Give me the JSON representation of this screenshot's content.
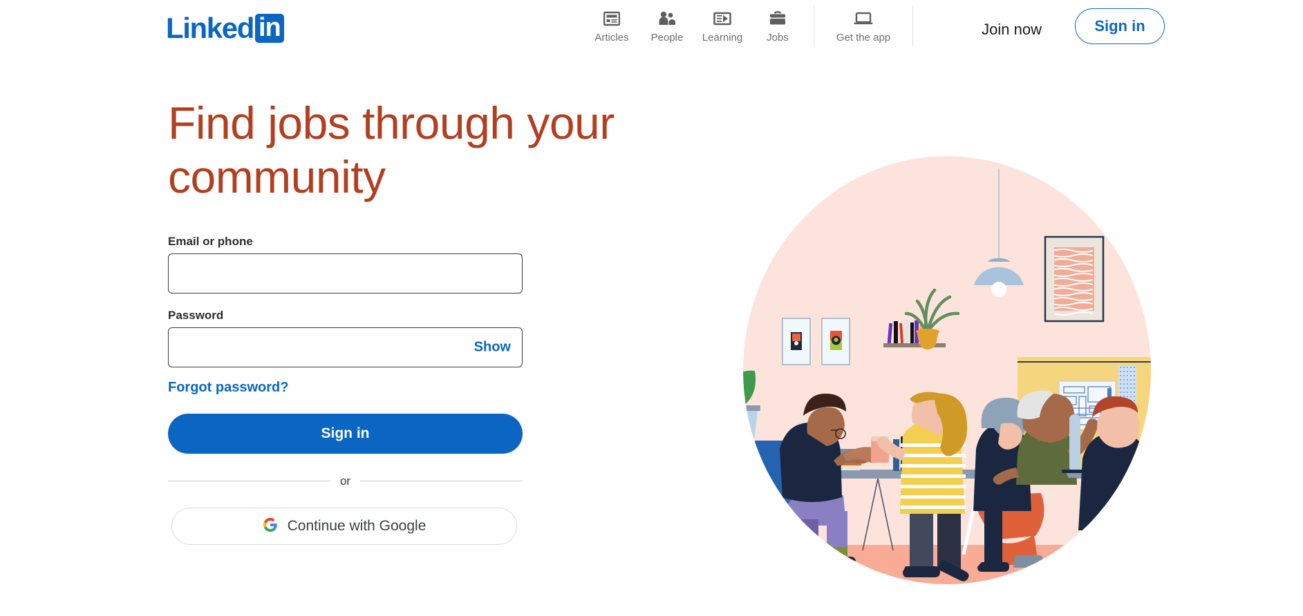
{
  "brand": {
    "logo_word": "Linked",
    "logo_in": "in",
    "accent_blue": "#0a66c2",
    "headline_color": "#b24020"
  },
  "header": {
    "nav": [
      {
        "label": "Articles",
        "icon": "articles-icon"
      },
      {
        "label": "People",
        "icon": "people-icon"
      },
      {
        "label": "Learning",
        "icon": "learning-icon"
      },
      {
        "label": "Jobs",
        "icon": "briefcase-icon"
      },
      {
        "label": "Get the app",
        "icon": "laptop-icon"
      }
    ],
    "join_now": "Join now",
    "sign_in": "Sign in"
  },
  "hero": {
    "headline": "Find jobs through your community"
  },
  "form": {
    "email_label": "Email or phone",
    "email_value": "",
    "email_placeholder": "",
    "password_label": "Password",
    "password_value": "",
    "password_placeholder": "",
    "show_label": "Show",
    "forgot_label": "Forgot password?",
    "submit_label": "Sign in",
    "divider_label": "or",
    "google_label": "Continue with Google",
    "google_icon": "google-g-icon"
  },
  "illustration": {
    "name": "coworking-office-illustration",
    "circle_color": "#fce4dd",
    "floor_color": "#f9ab95",
    "accent_colors": {
      "chair_blue": "#2463b0",
      "chair_green": "#6b7d33",
      "whiteboard_yellow": "#f5d57e",
      "skirt_orange": "#e0603a",
      "desk_gray": "#8a99ad",
      "lamp_blue": "#a9c3dd",
      "plant_green": "#4f9455",
      "pot_gold": "#e0a22e"
    }
  }
}
